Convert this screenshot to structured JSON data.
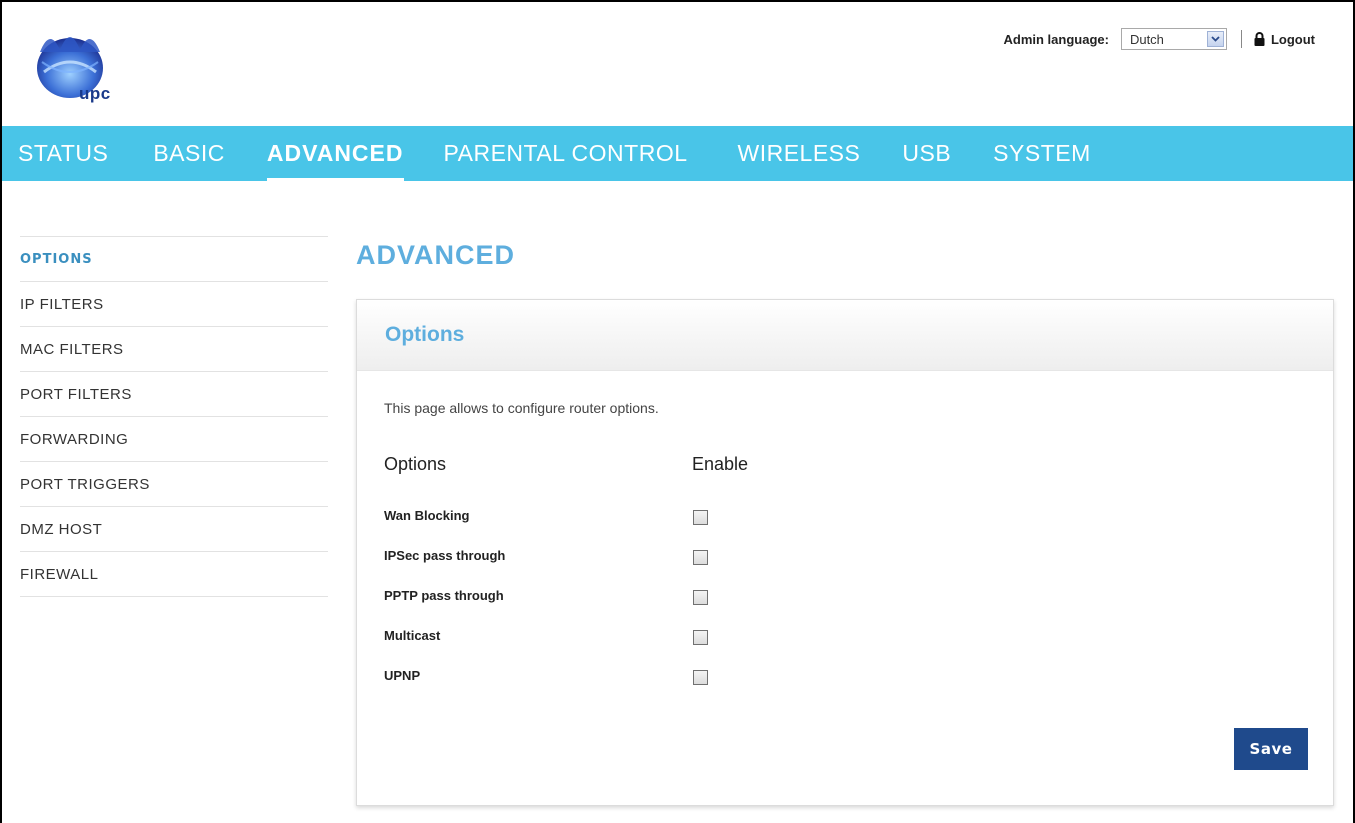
{
  "header": {
    "logo_text": "upc",
    "admin_language_label": "Admin language:",
    "language_selected": "Dutch",
    "logout_label": "Logout"
  },
  "nav": {
    "items": [
      {
        "label": "STATUS"
      },
      {
        "label": "BASIC"
      },
      {
        "label": "ADVANCED"
      },
      {
        "label": "PARENTAL CONTROL"
      },
      {
        "label": "WIRELESS"
      },
      {
        "label": "USB"
      },
      {
        "label": "SYSTEM"
      }
    ],
    "active": "ADVANCED"
  },
  "sidebar": {
    "items": [
      {
        "label": "OPTIONS"
      },
      {
        "label": "IP FILTERS"
      },
      {
        "label": "MAC FILTERS"
      },
      {
        "label": "PORT FILTERS"
      },
      {
        "label": "FORWARDING"
      },
      {
        "label": "PORT TRIGGERS"
      },
      {
        "label": "DMZ HOST"
      },
      {
        "label": "FIREWALL"
      }
    ],
    "active": "OPTIONS"
  },
  "main": {
    "page_title": "ADVANCED",
    "panel_title": "Options",
    "description": "This page allows to configure router options.",
    "col_options": "Options",
    "col_enable": "Enable",
    "rows": [
      {
        "label": "Wan Blocking",
        "checked": false
      },
      {
        "label": "IPSec pass through",
        "checked": false
      },
      {
        "label": "PPTP pass through",
        "checked": false
      },
      {
        "label": "Multicast",
        "checked": false
      },
      {
        "label": "UPNP",
        "checked": false
      }
    ],
    "save_label": "Save"
  },
  "colors": {
    "nav_bg": "#49c5e8",
    "accent_title": "#5eaede",
    "save_button": "#1f4a8c"
  }
}
